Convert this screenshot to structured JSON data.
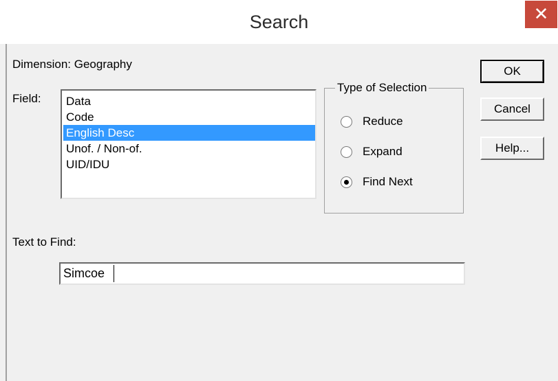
{
  "window": {
    "title": "Search",
    "close_glyph": "✕"
  },
  "dimension_label": "Dimension: Geography",
  "field": {
    "label": "Field:",
    "items": [
      "Data",
      "Code",
      "English Desc",
      "Unof. / Non-of.",
      "UID/IDU"
    ],
    "selected_index": 2
  },
  "selection_group": {
    "title": "Type of Selection",
    "options": [
      {
        "label": "Reduce",
        "checked": false
      },
      {
        "label": "Expand",
        "checked": false
      },
      {
        "label": "Find Next",
        "checked": true
      }
    ]
  },
  "buttons": {
    "ok": "OK",
    "cancel": "Cancel",
    "help": "Help..."
  },
  "text_to_find": {
    "label": "Text to Find:",
    "value": "Simcoe"
  },
  "colors": {
    "close_button": "#c7493b",
    "selection_highlight": "#3399ff"
  }
}
